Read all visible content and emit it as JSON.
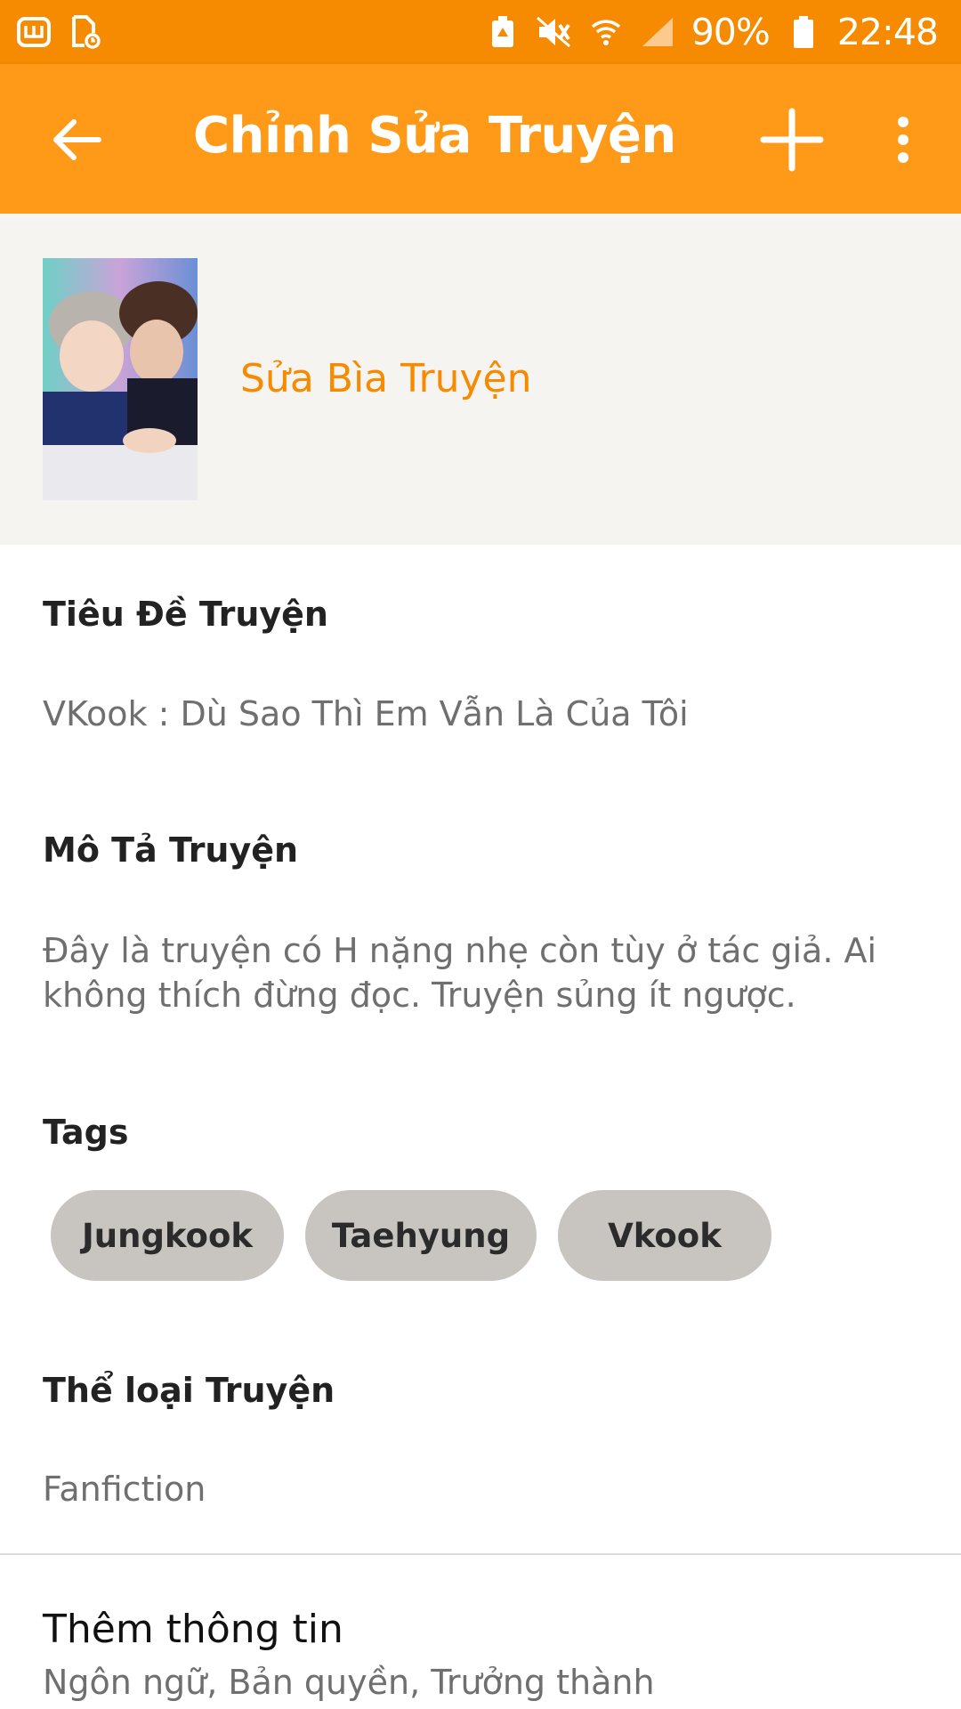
{
  "status_bar": {
    "left_icons": [
      "wattpad-notification-icon",
      "document-sync-icon"
    ],
    "right_icons": [
      "battery-saver-icon",
      "mute-icon",
      "wifi-icon",
      "signal-icon",
      "battery-icon"
    ],
    "battery_percent": "90%",
    "time": "22:48"
  },
  "app_bar": {
    "title": "Chỉnh Sửa Truyện",
    "back_icon": "arrow-left-icon",
    "add_icon": "plus-icon",
    "more_icon": "more-vertical-icon"
  },
  "cover": {
    "edit_label": "Sửa Bìa Truyện"
  },
  "story": {
    "title_label": "Tiêu Đề Truyện",
    "title_value": "VKook : Dù Sao Thì Em Vẫn Là Của Tôi",
    "description_label": "Mô Tả Truyện",
    "description_value": "Đây là truyện có H nặng nhẹ còn tùy ở tác giả. Ai không thích đừng đọc. Truyện sủng ít ngược.",
    "tags_label": "Tags",
    "tags": [
      "Jungkook",
      "Taehyung",
      "Vkook"
    ],
    "category_label": "Thể loại Truyện",
    "category_value": "Fanfiction"
  },
  "more_info": {
    "title": "Thêm thông tin",
    "subtitle": "Ngôn ngữ, Bản quyền, Trưởng thành"
  },
  "colors": {
    "status_bar": "#F68A00",
    "app_bar": "#FF9A18",
    "accent": "#F68A00",
    "tag_bg": "#C8C4BF"
  }
}
